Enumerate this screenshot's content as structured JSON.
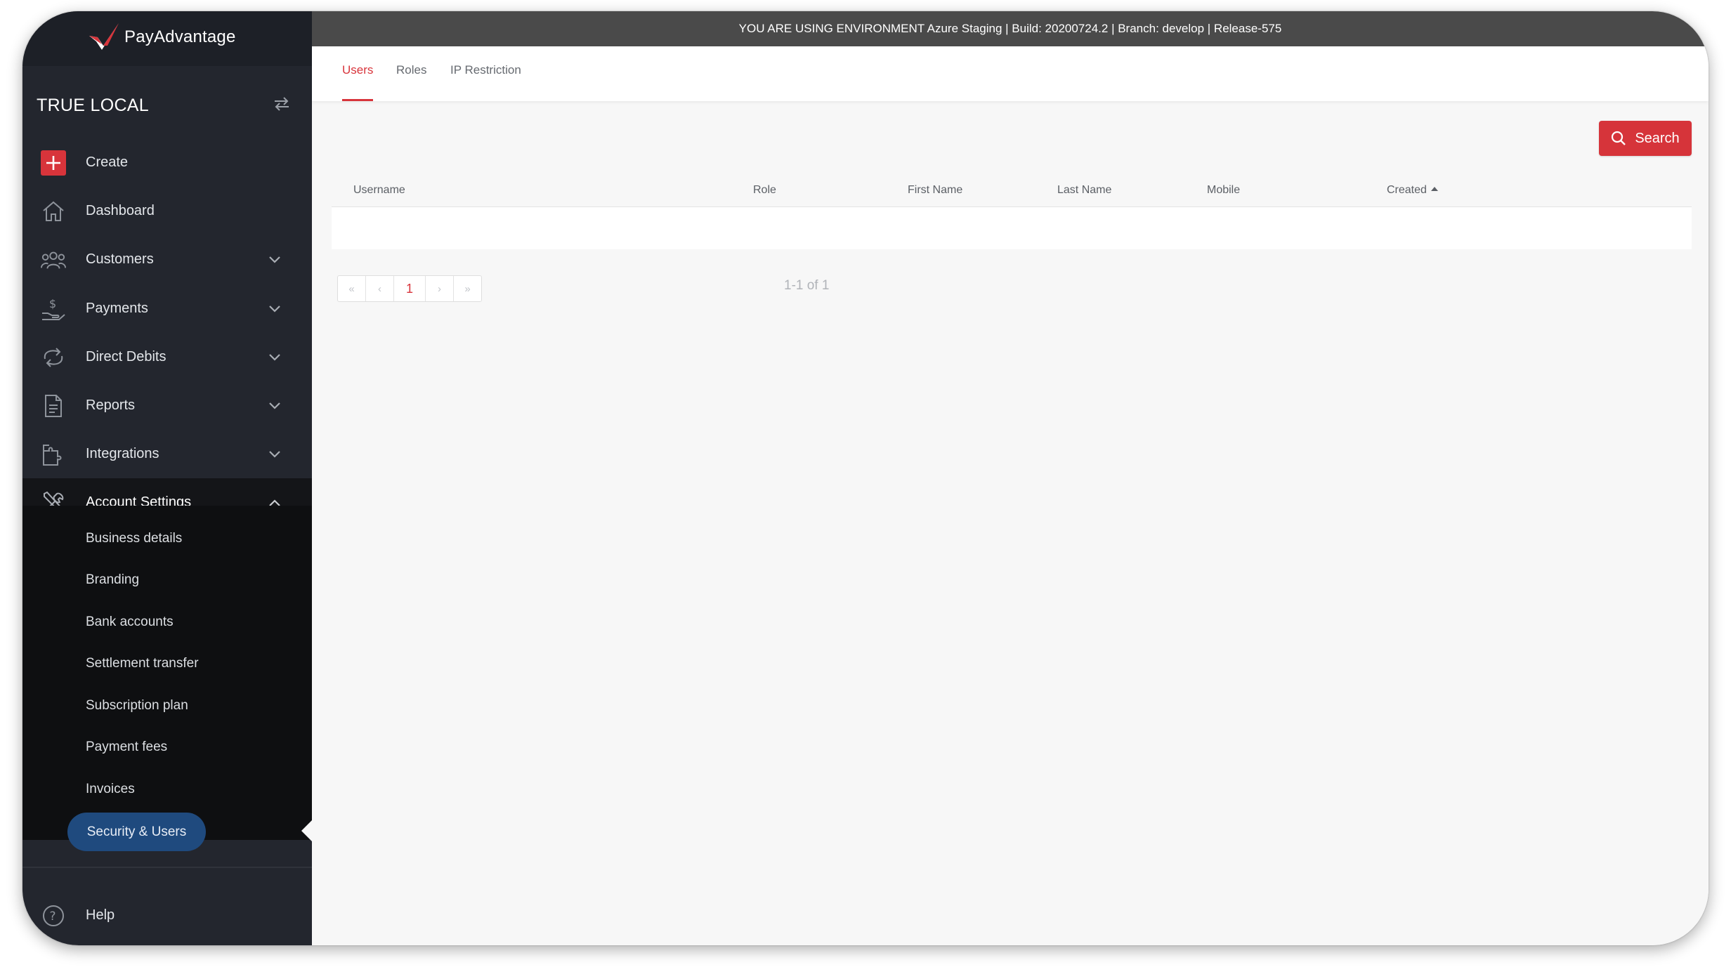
{
  "env_bar": {
    "text": "YOU ARE USING ENVIRONMENT Azure Staging | Build: 20200724.2 | Branch: develop | Release-575"
  },
  "brand": {
    "name": "PayAdvantage",
    "accent": "#d8343b"
  },
  "sidebar": {
    "org_name": "TRUE LOCAL",
    "items": [
      {
        "label": "Create",
        "icon": "plus-icon"
      },
      {
        "label": "Dashboard",
        "icon": "home-icon"
      },
      {
        "label": "Customers",
        "icon": "users-icon",
        "expandable": true
      },
      {
        "label": "Payments",
        "icon": "hand-dollar-icon",
        "expandable": true
      },
      {
        "label": "Direct Debits",
        "icon": "repeat-icon",
        "expandable": true
      },
      {
        "label": "Reports",
        "icon": "document-icon",
        "expandable": true
      },
      {
        "label": "Integrations",
        "icon": "puzzle-icon",
        "expandable": true
      },
      {
        "label": "Account Settings",
        "icon": "tools-icon",
        "expanded": true
      }
    ],
    "subitems": [
      "Business details",
      "Branding",
      "Bank accounts",
      "Settlement transfer",
      "Subscription plan",
      "Payment fees",
      "Invoices",
      "Security & Users"
    ],
    "active_subitem": "Security & Users",
    "help_label": "Help"
  },
  "tabs": [
    {
      "label": "Users",
      "active": true
    },
    {
      "label": "Roles",
      "active": false
    },
    {
      "label": "IP Restriction",
      "active": false
    }
  ],
  "search_button": {
    "label": "Search"
  },
  "table": {
    "columns": [
      "Username",
      "Role",
      "First Name",
      "Last Name",
      "Mobile",
      "Created"
    ],
    "sorted_column": "Created",
    "sort_direction": "asc",
    "rows": []
  },
  "pagination": {
    "first": "«",
    "prev": "‹",
    "current": "1",
    "next": "›",
    "last": "»",
    "info": "1-1 of 1"
  }
}
